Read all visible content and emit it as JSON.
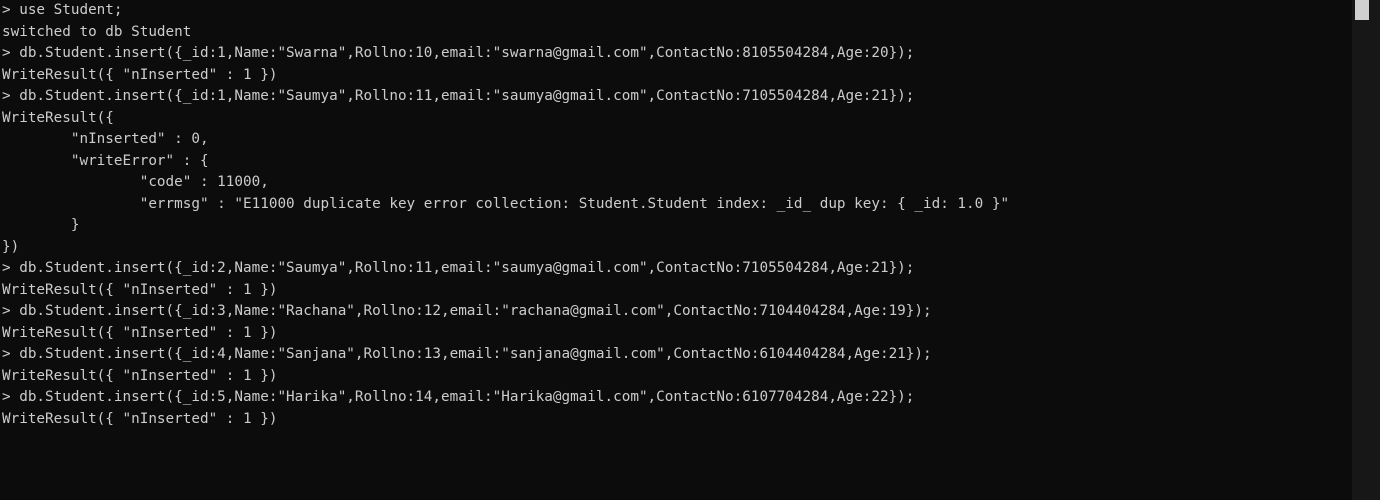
{
  "terminal": {
    "lines": [
      "> use Student;",
      "switched to db Student",
      "> db.Student.insert({_id:1,Name:\"Swarna\",Rollno:10,email:\"swarna@gmail.com\",ContactNo:8105504284,Age:20});",
      "WriteResult({ \"nInserted\" : 1 })",
      "> db.Student.insert({_id:1,Name:\"Saumya\",Rollno:11,email:\"saumya@gmail.com\",ContactNo:7105504284,Age:21});",
      "WriteResult({",
      "        \"nInserted\" : 0,",
      "        \"writeError\" : {",
      "                \"code\" : 11000,",
      "                \"errmsg\" : \"E11000 duplicate key error collection: Student.Student index: _id_ dup key: { _id: 1.0 }\"",
      "        }",
      "})",
      "> db.Student.insert({_id:2,Name:\"Saumya\",Rollno:11,email:\"saumya@gmail.com\",ContactNo:7105504284,Age:21});",
      "WriteResult({ \"nInserted\" : 1 })",
      "> db.Student.insert({_id:3,Name:\"Rachana\",Rollno:12,email:\"rachana@gmail.com\",ContactNo:7104404284,Age:19});",
      "WriteResult({ \"nInserted\" : 1 })",
      "> db.Student.insert({_id:4,Name:\"Sanjana\",Rollno:13,email:\"sanjana@gmail.com\",ContactNo:6104404284,Age:21});",
      "WriteResult({ \"nInserted\" : 1 })",
      "> db.Student.insert({_id:5,Name:\"Harika\",Rollno:14,email:\"Harika@gmail.com\",ContactNo:6107704284,Age:22});",
      "WriteResult({ \"nInserted\" : 1 })"
    ]
  },
  "colors": {
    "background": "#0c0c0c",
    "text": "#cccccc",
    "scrollbar_track": "#171717",
    "scrollbar_thumb": "#d0d0d0"
  }
}
